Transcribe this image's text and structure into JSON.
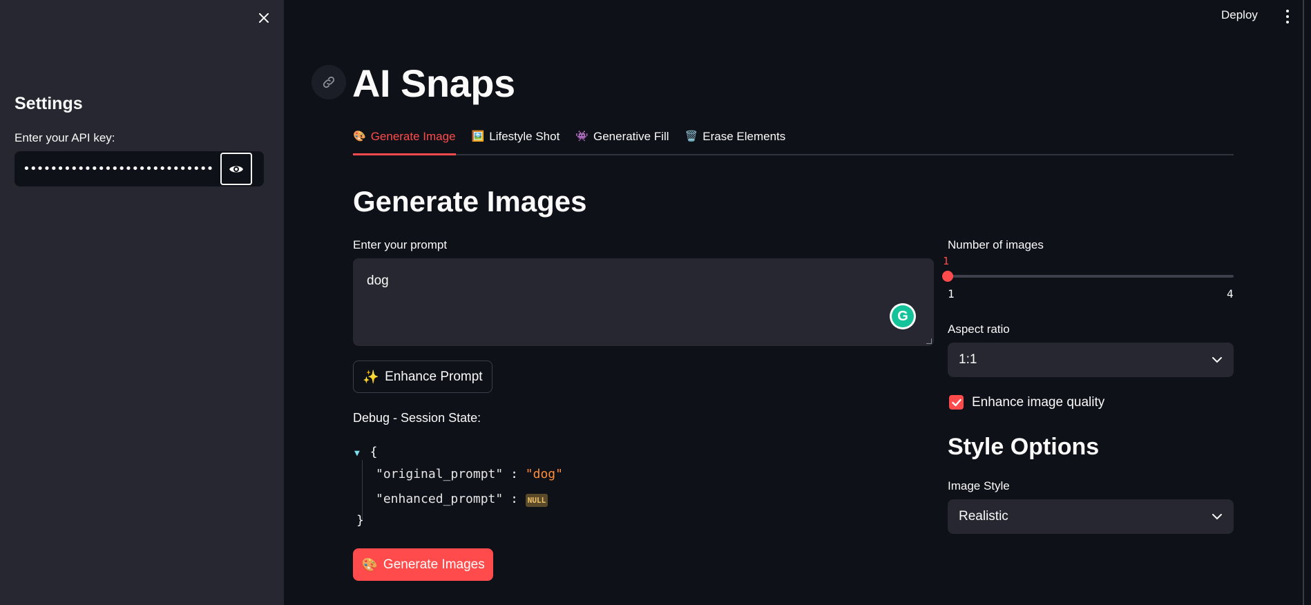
{
  "sidebar": {
    "title": "Settings",
    "api_label": "Enter your API key:",
    "api_value": "••••••••••••••••••••••••••••••••••"
  },
  "topbar": {
    "deploy_label": "Deploy"
  },
  "page": {
    "title": "AI Snaps"
  },
  "tabs": [
    {
      "icon": "🎨",
      "label": "Generate Image",
      "active": true
    },
    {
      "icon": "🖼️",
      "label": "Lifestyle Shot",
      "active": false
    },
    {
      "icon": "👾",
      "label": "Generative Fill",
      "active": false
    },
    {
      "icon": "🗑️",
      "label": "Erase Elements",
      "active": false
    }
  ],
  "generate": {
    "title": "Generate Images",
    "prompt_label": "Enter your prompt",
    "prompt_value": "dog",
    "enhance_button": "Enhance Prompt",
    "enhance_icon": "✨",
    "debug_label": "Debug - Session State:",
    "session_state": {
      "original_key": "\"original_prompt\"",
      "original_value": "\"dog\"",
      "enhanced_key": "\"enhanced_prompt\"",
      "enhanced_value": "NULL"
    },
    "generate_button": "Generate Images",
    "generate_icon": "🎨"
  },
  "options": {
    "num_images_label": "Number of images",
    "num_images_value": "1",
    "num_images_min": "1",
    "num_images_max": "4",
    "aspect_label": "Aspect ratio",
    "aspect_value": "1:1",
    "enhance_quality_label": "Enhance image quality",
    "enhance_quality_checked": true,
    "style_title": "Style Options",
    "image_style_label": "Image Style",
    "image_style_value": "Realistic"
  },
  "colors": {
    "accent": "#ff4b4b",
    "background": "#0e1117",
    "sidebar": "#262730"
  }
}
